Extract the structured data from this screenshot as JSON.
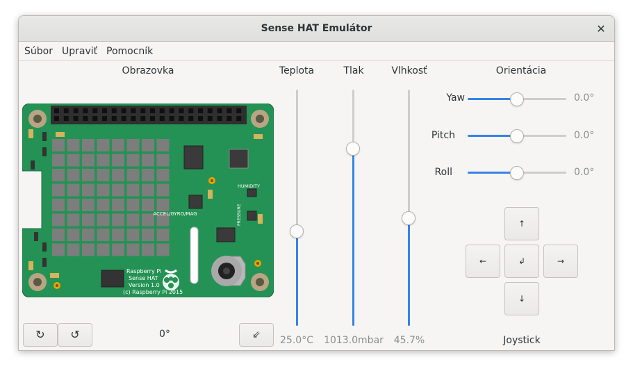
{
  "window": {
    "title": "Sense HAT Emulátor"
  },
  "menu": {
    "items": [
      "Súbor",
      "Upraviť",
      "Pomocník"
    ]
  },
  "display": {
    "label": "Obrazovka",
    "rotation_value": "0°",
    "rotate_cw_glyph": "↻",
    "rotate_ccw_glyph": "↺",
    "flip_glyph": "⇙",
    "board_text": {
      "name": "Raspberry Pi",
      "product": "Sense HAT",
      "version": "Version 1.0",
      "copyright": "(c) Raspberry Pi 2015",
      "accel": "ACCEL/GYRO/MAG",
      "humidity": "HUMIDITY",
      "pressure": "PRESSURE"
    },
    "board_color": "#249254"
  },
  "sensors": {
    "temperature": {
      "label": "Teplota",
      "value": "25.0°C",
      "level": 0.4
    },
    "pressure": {
      "label": "Tlak",
      "value": "1013.0mbar",
      "level": 0.75
    },
    "humidity": {
      "label": "Vlhkosť",
      "value": "45.7%",
      "level": 0.457
    }
  },
  "orientation": {
    "label": "Orientácia",
    "yaw": {
      "label": "Yaw",
      "value": "0.0°",
      "level": 0.5
    },
    "pitch": {
      "label": "Pitch",
      "value": "0.0°",
      "level": 0.5
    },
    "roll": {
      "label": "Roll",
      "value": "0.0°",
      "level": 0.5
    }
  },
  "joystick": {
    "label": "Joystick",
    "up": "↑",
    "left": "←",
    "enter": "↲",
    "right": "→",
    "down": "↓"
  },
  "colors": {
    "accent": "#3584e4",
    "led_off": "#7d7d7d"
  }
}
